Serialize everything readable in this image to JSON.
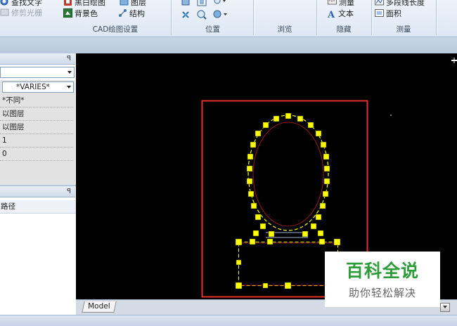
{
  "ribbon": {
    "cad_group": {
      "find_text": "查找文字",
      "trim_raster": "修剪光栅",
      "black_bg": "黑白绘图",
      "layer": "图层",
      "bg_color": "背景色",
      "structure": "结构",
      "label": "CAD绘图设置"
    },
    "position_group": {
      "label": "位置"
    },
    "browse_group": {
      "label": "浏览"
    },
    "hide_group": {
      "measure": "测量",
      "text": "文本",
      "label": "隐藏"
    },
    "measure_group": {
      "polyline_length": "多段线长度",
      "area": "面积",
      "label": "测量"
    }
  },
  "properties_panel": {
    "pin": "ꟼ",
    "combo_value": "*VARIES*",
    "rows": [
      "*不同*",
      "以图层",
      "以图层",
      "1",
      "0"
    ]
  },
  "layers_panel": {
    "pin": "ꟼ",
    "row_label": "路径"
  },
  "canvas": {
    "tab_model": "Model",
    "accent": "#e52f2f",
    "entity_color": "#ffff00"
  },
  "watermark": {
    "main": "百科全说",
    "sub": "助你轻松解决"
  },
  "colors": {
    "ribbon": "#dde7f3",
    "canvas": "#000000",
    "selection_frame": "#e52f2f",
    "grip": "#ffff00",
    "watermark_green": "#2d9d3a"
  }
}
